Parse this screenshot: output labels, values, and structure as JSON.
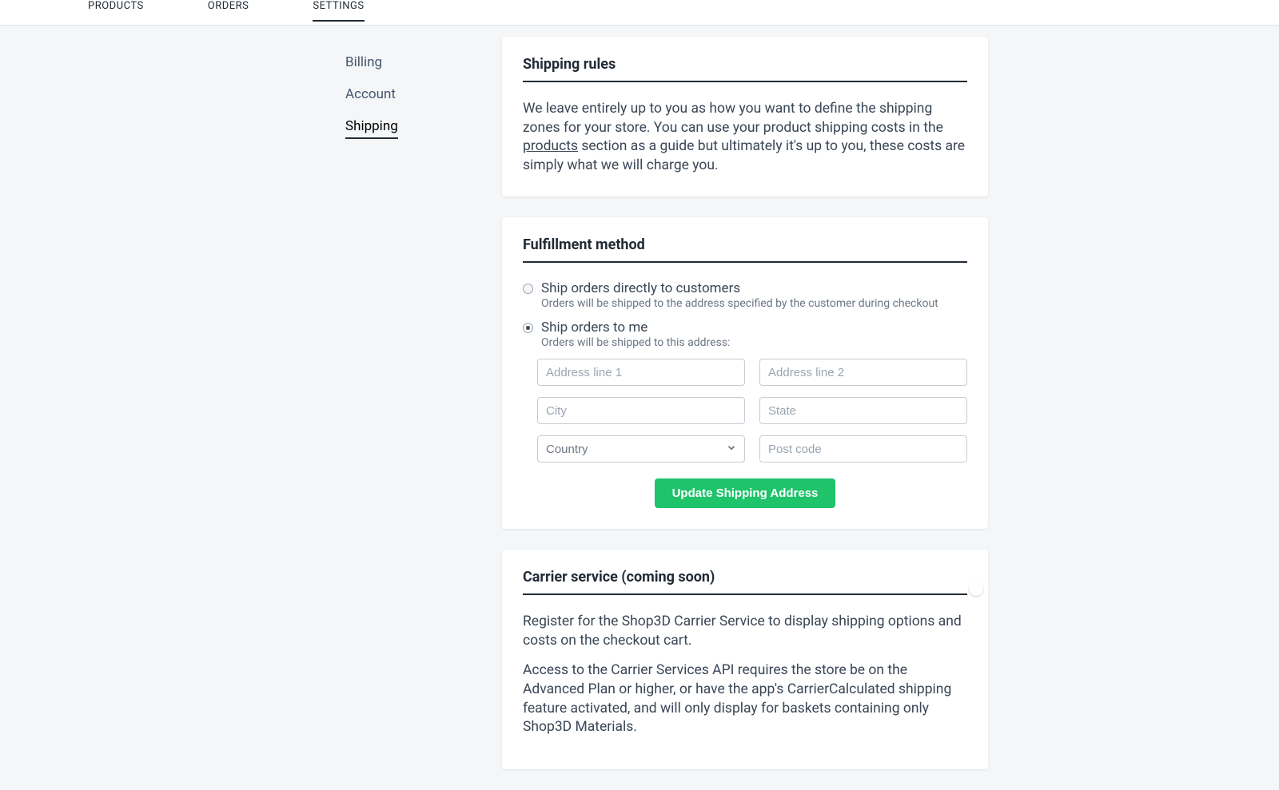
{
  "topnav": {
    "items": [
      {
        "label": "PRODUCTS"
      },
      {
        "label": "ORDERS"
      },
      {
        "label": "SETTINGS"
      }
    ]
  },
  "sidenav": {
    "items": [
      {
        "label": "Billing"
      },
      {
        "label": "Account"
      },
      {
        "label": "Shipping"
      }
    ]
  },
  "shipping_rules": {
    "title": "Shipping rules",
    "body_before_link": "We leave entirely up to you as how you want to define the shipping zones for your store. You can use your product shipping costs in the ",
    "link_text": "products",
    "body_after_link": " section as a guide but ultimately it's up to you, these costs are simply what we will charge you."
  },
  "fulfillment": {
    "title": "Fulfillment method",
    "opt_direct": {
      "label": "Ship orders directly to customers",
      "sub": "Orders will be shipped to the address specified by the customer during checkout"
    },
    "opt_me": {
      "label": "Ship orders to me",
      "sub": "Orders will be shipped to this address:"
    },
    "fields": {
      "addr1_ph": "Address line 1",
      "addr2_ph": "Address line 2",
      "city_ph": "City",
      "state_ph": "State",
      "country_ph": "Country",
      "post_ph": "Post code"
    },
    "submit_label": "Update Shipping Address"
  },
  "carrier": {
    "title": "Carrier service (coming soon)",
    "p1": "Register for the Shop3D Carrier Service to display shipping options and costs on the checkout cart.",
    "p2": "Access to the Carrier Services API requires the store be on the Advanced Plan or higher, or have the app's CarrierCalculated shipping feature activated, and will only display for baskets containing only Shop3D Materials."
  }
}
